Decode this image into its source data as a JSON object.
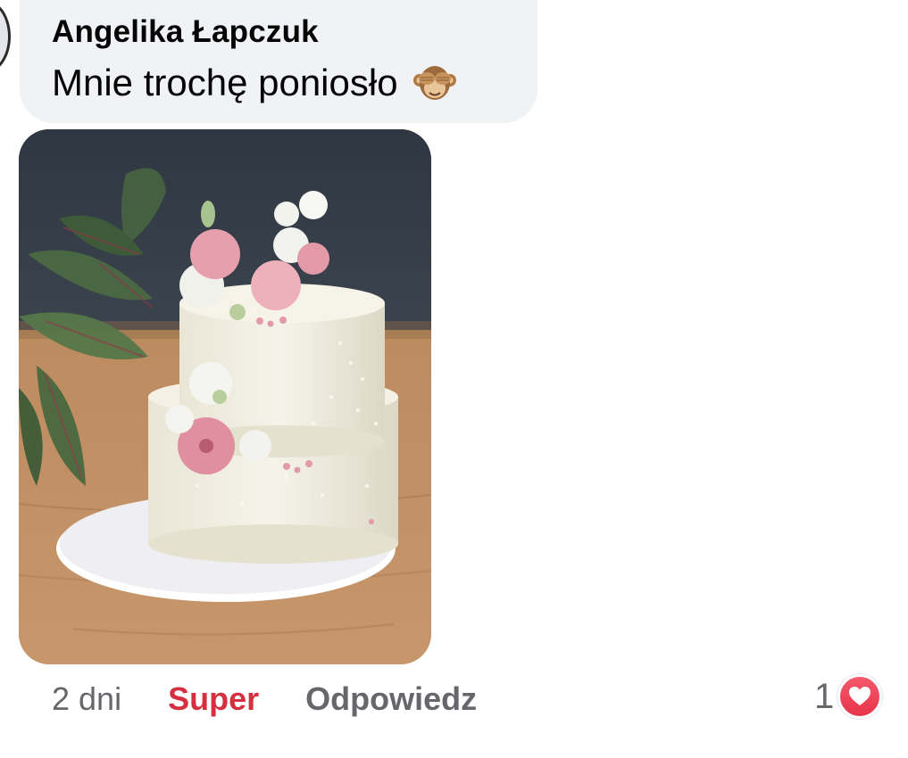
{
  "comment": {
    "author": "Angelika Łapczuk",
    "text": "Mnie trochę poniosło",
    "emoji_icon": "see-no-evil-monkey-icon",
    "attachment": {
      "type": "photo",
      "subject_icon": "two-tier-wedding-cake-photo"
    }
  },
  "actions": {
    "time": "2 dni",
    "reaction": "Super",
    "reaction_color": "#d4303f",
    "reply": "Odpowiedz"
  },
  "reactions": {
    "count": "1",
    "icon": "heart-icon",
    "color": "#e8334a"
  }
}
